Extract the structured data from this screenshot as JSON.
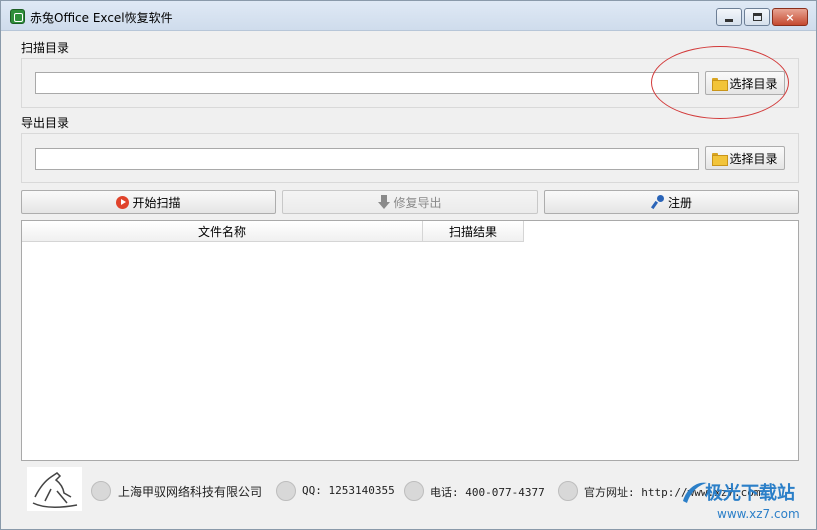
{
  "window": {
    "title": "赤兔Office Excel恢复软件",
    "controls": {
      "minimize": "minimize",
      "maximize": "maximize",
      "close": "×"
    }
  },
  "scan": {
    "label": "扫描目录",
    "path_value": "",
    "browse_label": "选择目录"
  },
  "export": {
    "label": "导出目录",
    "path_value": "",
    "browse_label": "选择目录"
  },
  "toolbar": {
    "start_scan_label": "开始扫描",
    "repair_export_label": "修复导出",
    "register_label": "注册"
  },
  "table": {
    "columns": [
      "文件名称",
      "扫描结果"
    ],
    "rows": []
  },
  "footer": {
    "company": "上海甲驭网络科技有限公司",
    "qq": "QQ: 1253140355",
    "phone": "电话: 400-077-4377",
    "website": "官方网址: http://www.xz7.com"
  },
  "watermark": {
    "main": "极光下载站",
    "sub": "www.xz7.com"
  },
  "icons": {
    "app": "excel-app-icon",
    "browse": "folder-icon",
    "start": "play-icon",
    "export": "down-arrow-icon",
    "register": "key-icon"
  },
  "colors": {
    "accent_red": "#d23a3a",
    "watermark_blue": "#2b7fc8"
  }
}
